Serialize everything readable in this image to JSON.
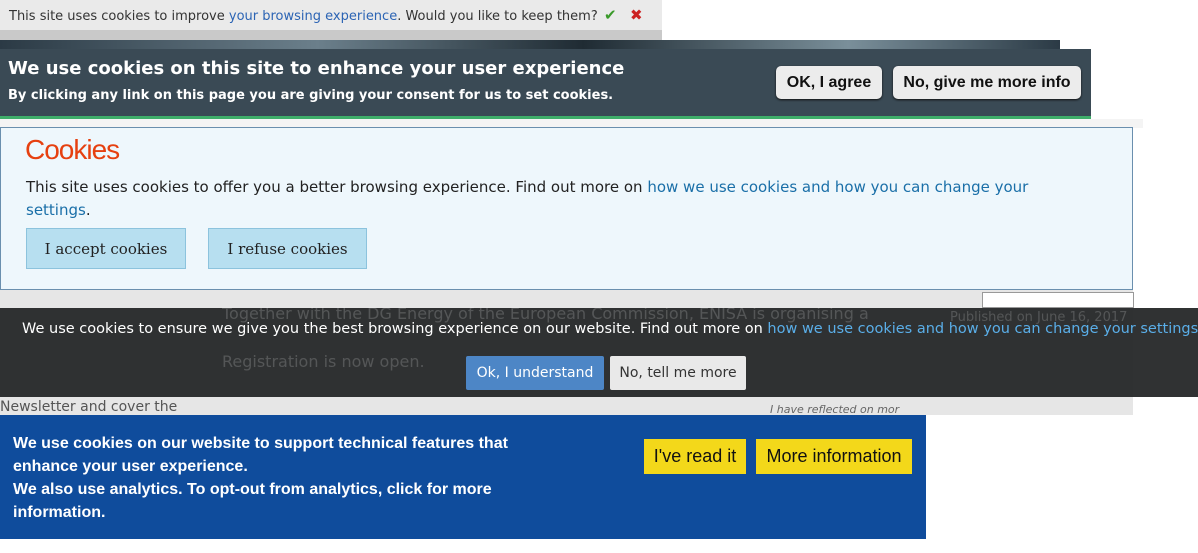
{
  "banner1": {
    "text_before": "This site uses cookies to improve ",
    "link": "your browsing experience",
    "text_after": ". Would you like to keep them?",
    "accept_glyph": "✔",
    "reject_glyph": "✖"
  },
  "banner2": {
    "heading": "We use cookies on this site to enhance your user experience",
    "subtext": "By clicking any link on this page you are giving your consent for us to set cookies.",
    "agree_label": "OK, I agree",
    "info_label": "No, give me more info"
  },
  "banner3": {
    "title": "Cookies",
    "text": "This site uses cookies to offer you a better browsing experience. Find out more on ",
    "link": "how we use cookies and how you can change your settings",
    "period": ".",
    "accept_label": "I accept cookies",
    "refuse_label": "I refuse cookies"
  },
  "banner4": {
    "text": "We use cookies to ensure we give you the best browsing experience on our website. Find out more on ",
    "link": "how we use cookies and how you can change your settings.",
    "ok_label": "Ok, I understand",
    "more_label": "No, tell me more",
    "behind_line1": "Together with the DG Energy of the European Commission, ENISA is organising a",
    "behind_line2": "Registration is now open.",
    "behind_right": "Published on June 16, 2017"
  },
  "banner5": {
    "line1": "We use cookies on our website to support technical features that enhance your user experience.",
    "line2": "We also use analytics. To opt-out from analytics, click for more information.",
    "read_label": "I've read it",
    "more_label": "More information"
  },
  "page_peek": {
    "left_text": "Newsletter and cover the",
    "right_text": "I have reflected on mor"
  }
}
